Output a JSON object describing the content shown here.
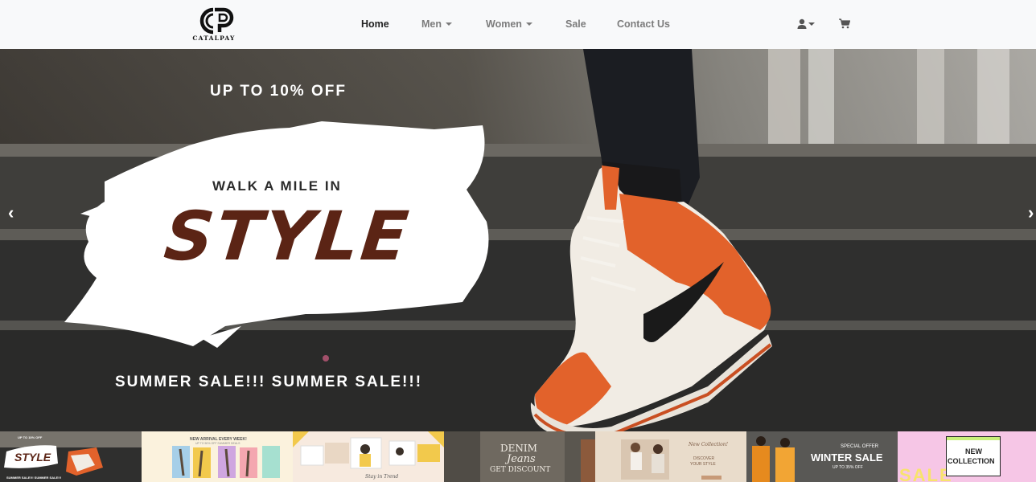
{
  "brand": {
    "name": "CATALPAY"
  },
  "nav": {
    "home": "Home",
    "men": "Men",
    "women": "Women",
    "sale": "Sale",
    "contact": "Contact Us"
  },
  "hero": {
    "offer": "UP TO 10% OFF",
    "tagline": "WALK A MILE IN",
    "headline": "STYLE",
    "banner": "SUMMER SALE!!!  SUMMER SALE!!!",
    "prev": "‹",
    "next": "›"
  },
  "thumbnails": {
    "t1": {
      "small": "UP TO 10% OFF",
      "big": "STYLE",
      "foot": "SUMMER SALE!!! SUMMER SALE!!!"
    },
    "t2": {
      "title": "NEW ARRIVAL EVERY WEEK!",
      "sub": "UP TO 50% OFF SUMMER DEALS"
    },
    "t3": {
      "foot": "Stay in Trend"
    },
    "t4": {
      "line1": "DENIM",
      "line2": "Jeans",
      "line3": "GET DISCOUNT"
    },
    "t5": {
      "line1": "New Collection!",
      "line2": "DISCOVER",
      "line3": "YOUR STYLE"
    },
    "t6": {
      "line1": "SPECIAL OFFER",
      "line2": "WINTER SALE",
      "line3": "UP TO 35% OFF"
    },
    "t7": {
      "line1": "NEW",
      "line2": "COLLECTION",
      "bg": "SALE"
    }
  },
  "colors": {
    "navbar_bg": "#f8f9fa",
    "style_brown": "#5b2415",
    "shoe_orange": "#e2622b"
  }
}
